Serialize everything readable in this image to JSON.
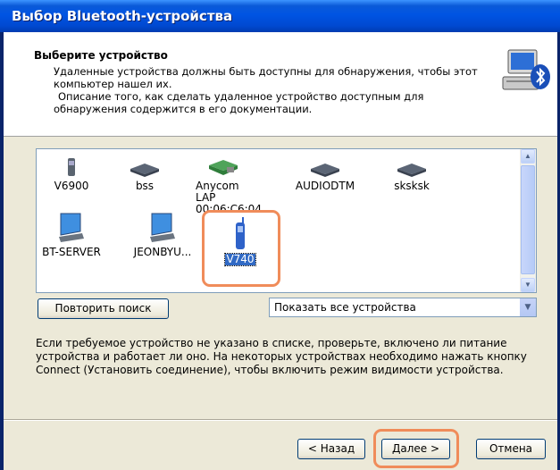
{
  "window": {
    "title": "Выбор Bluetooth-устройства"
  },
  "header": {
    "title": "Выберите устройство",
    "line1": "Удаленные устройства должны быть доступны для обнаружения, чтобы этот компьютер нашел их.",
    "line2": "Описание того, как сделать удаленное устройство доступным для обнаружения содержится в его документации.",
    "icon": "bluetooth-computer-icon"
  },
  "devices": [
    {
      "label": "V6900",
      "icon": "phone-icon"
    },
    {
      "label": "bss",
      "icon": "laptop-icon"
    },
    {
      "label": "Anycom LAP 00:06:C6:04...",
      "icon": "access-point-icon"
    },
    {
      "label": "AUDIODTM",
      "icon": "laptop-icon"
    },
    {
      "label": "sksksk",
      "icon": "laptop-icon"
    },
    {
      "label": "BT-SERVER",
      "icon": "computer-icon"
    },
    {
      "label": "JEONBYU...",
      "icon": "computer-icon"
    },
    {
      "label": "V740",
      "icon": "phone-icon",
      "selected": true
    }
  ],
  "buttons": {
    "rescan": "Повторить поиск",
    "back": "< Назад",
    "next": "Далее >",
    "cancel": "Отмена"
  },
  "filter": {
    "selected": "Показать все устройства"
  },
  "info_text": "Если требуемое устройство не указано в списке, проверьте, включено ли питание устройства и работает ли оно. На некоторых устройствах необходимо нажать кнопку Connect (Установить соединение), чтобы включить режим видимости устройства.",
  "colors": {
    "highlight": "#f08c5a",
    "selection": "#316ac5",
    "titlebar": "#0054e3"
  }
}
